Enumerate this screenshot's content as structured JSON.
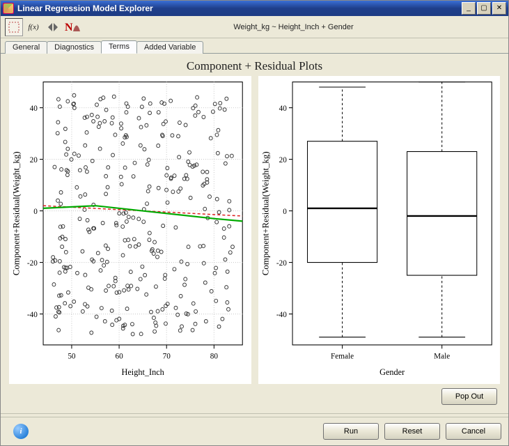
{
  "window": {
    "title": "Linear Regression Model Explorer"
  },
  "toolbar": {
    "formula": "Weight_kg ~ Height_Inch + Gender"
  },
  "tabs": {
    "general": "General",
    "diagnostics": "Diagnostics",
    "terms": "Terms",
    "added": "Added Variable"
  },
  "page_title": "Component + Residual Plots",
  "left_plot": {
    "xlabel": "Height_Inch",
    "ylabel": "Component+Residual(Weight_kg)",
    "x_ticks": [
      "50",
      "60",
      "70",
      "80"
    ],
    "y_ticks": [
      "-40",
      "-20",
      "0",
      "20",
      "40"
    ]
  },
  "right_plot": {
    "xlabel": "Gender",
    "ylabel": "Component+Residual(Weight_kg)",
    "categories": [
      "Female",
      "Male"
    ],
    "y_ticks": [
      "-40",
      "-20",
      "0",
      "20",
      "40"
    ]
  },
  "buttons": {
    "popout": "Pop Out",
    "run": "Run",
    "reset": "Reset",
    "cancel": "Cancel"
  },
  "chart_data": [
    {
      "type": "scatter",
      "title": "Component+Residual vs Height_Inch",
      "xlabel": "Height_Inch",
      "ylabel": "Component+Residual(Weight_kg)",
      "xlim": [
        44,
        86
      ],
      "ylim": [
        -52,
        50
      ],
      "grid": true,
      "fit_line": {
        "start": [
          44,
          2
        ],
        "end": [
          86,
          -2
        ],
        "style": "dashed-red"
      },
      "loess_line": {
        "points": [
          [
            44,
            1
          ],
          [
            55,
            2
          ],
          [
            70,
            -1
          ],
          [
            80,
            -3
          ],
          [
            86,
            -4
          ]
        ],
        "style": "solid-green"
      },
      "note": "approx 300 scattered points spanning full ranges, visually uniform spread"
    },
    {
      "type": "boxplot",
      "title": "Component+Residual by Gender",
      "xlabel": "Gender",
      "ylabel": "Component+Residual(Weight_kg)",
      "ylim": [
        -52,
        50
      ],
      "categories": [
        "Female",
        "Male"
      ],
      "boxes": [
        {
          "category": "Female",
          "whisker_low": -49,
          "q1": -20,
          "median": 1,
          "q3": 27,
          "whisker_high": 48
        },
        {
          "category": "Male",
          "whisker_low": -49,
          "q1": -25,
          "median": -2,
          "q3": 23,
          "whisker_high": 50
        }
      ]
    }
  ]
}
